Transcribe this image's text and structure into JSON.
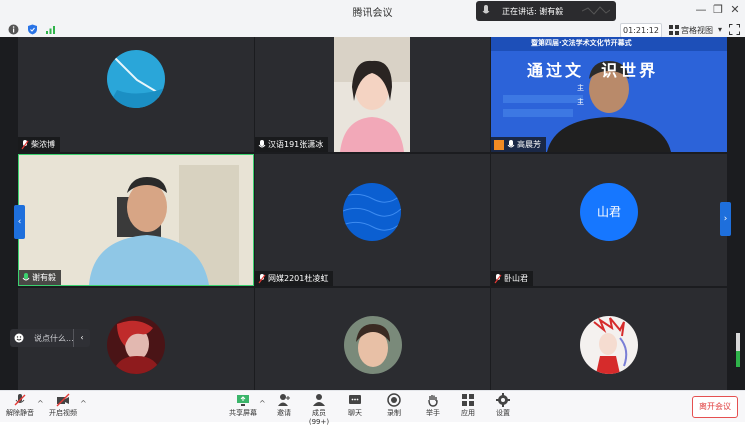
{
  "window": {
    "title": "腾讯会议",
    "controls": [
      "minimize",
      "restore",
      "close"
    ]
  },
  "speaking": {
    "label": "正在讲话:",
    "name": "谢有毅"
  },
  "status": {
    "timer": "01:21:12",
    "view_label": "宫格视图"
  },
  "participants": [
    {
      "name": "柴浓博",
      "muted": true
    },
    {
      "name": "汉语191张潇冰",
      "muted": false
    },
    {
      "name": "高晨芳",
      "muted": false,
      "host": true
    },
    {
      "name": "谢有毅",
      "muted": false,
      "speaking": true
    },
    {
      "name": "网媒2201杜凌虹",
      "muted": true
    },
    {
      "name": "卧山君",
      "muted": true,
      "avatar_text": "山君"
    },
    {
      "name": "",
      "muted": null
    },
    {
      "name": "",
      "muted": null
    },
    {
      "name": "",
      "muted": null
    }
  ],
  "banner": {
    "top_text": "暨第四届·文法学术文化节开幕式",
    "main_text": "通过文  识世界",
    "sub1": "主",
    "sub2": "主"
  },
  "chat": {
    "placeholder": "说点什么...",
    "collapse": "‹"
  },
  "toolbar": {
    "unmute": "解除静音",
    "start_video": "开启视频",
    "share_screen": "共享屏幕",
    "invite": "邀请",
    "members": "成员(99+)",
    "chat": "聊天",
    "record": "录制",
    "raise_hand": "举手",
    "apps": "应用",
    "settings": "设置",
    "leave": "离开会议"
  },
  "colors": {
    "accent": "#1e6fdc",
    "speaking_border": "#3bd16f",
    "leave": "#e03e3e",
    "avatar_blue": "#1677ff"
  }
}
